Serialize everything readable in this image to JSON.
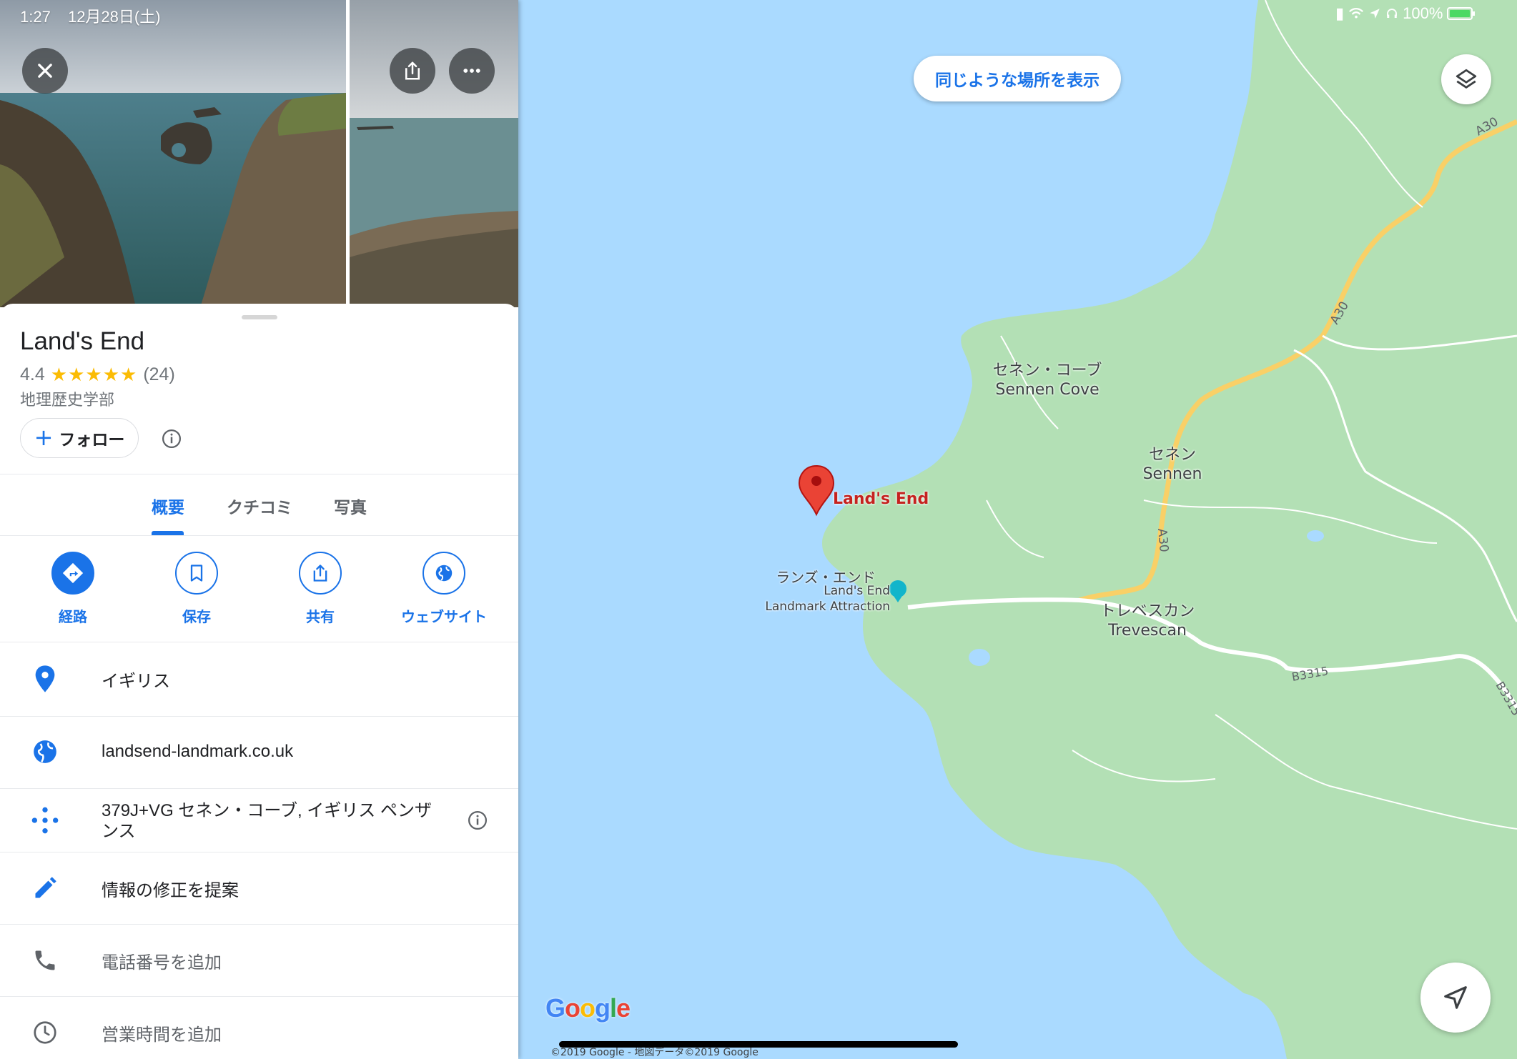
{
  "status_bar": {
    "time": "1:27",
    "date": "12月28日(土)",
    "battery": "100%"
  },
  "place": {
    "name": "Land's End",
    "rating": "4.4",
    "stars": "★★★★★",
    "review_count": "(24)",
    "category": "地理歴史学部"
  },
  "follow_button": {
    "label": "フォロー"
  },
  "tabs": [
    {
      "label": "概要",
      "active": true
    },
    {
      "label": "クチコミ",
      "active": false
    },
    {
      "label": "写真",
      "active": false
    }
  ],
  "actions": [
    {
      "label": "経路",
      "icon": "directions-icon"
    },
    {
      "label": "保存",
      "icon": "bookmark-icon"
    },
    {
      "label": "共有",
      "icon": "share-icon"
    },
    {
      "label": "ウェブサイト",
      "icon": "globe-icon"
    }
  ],
  "details": {
    "address": "イギリス",
    "website": "landsend-landmark.co.uk",
    "plus_code": "379J+VG セネン・コーブ, イギリス ペンザンス",
    "plus_code_line2": "ンス",
    "suggest_edit": "情報の修正を提案",
    "add_phone": "電話番号を追加",
    "add_hours": "営業時間を追加"
  },
  "map": {
    "similar_places_button": "同じような場所を表示",
    "pin_label": "Land's End",
    "labels": {
      "sennen_cove_jp": "セネン・コーブ",
      "sennen_cove_en": "Sennen Cove",
      "sennen_jp": "セネン",
      "sennen_en": "Sennen",
      "lands_end_jp": "ランズ・エンド",
      "attraction_line1": "Land's End",
      "attraction_line2": "Landmark Attraction",
      "trevescan_jp": "トレベスカン",
      "trevescan_en": "Trevescan"
    },
    "roads": {
      "a30_1": "A30",
      "a30_2": "A30",
      "a30_3": "A30",
      "b3315_1": "B3315",
      "b3315_2": "B3315"
    },
    "google_logo": "Google",
    "copyright": "©2019 Google - 地図データ©2019 Google"
  },
  "colors": {
    "accent": "#1a73e8",
    "water": "#aadaff",
    "land": "#b3e0b5",
    "road_major": "#f9d067",
    "pin": "#ea4335"
  }
}
